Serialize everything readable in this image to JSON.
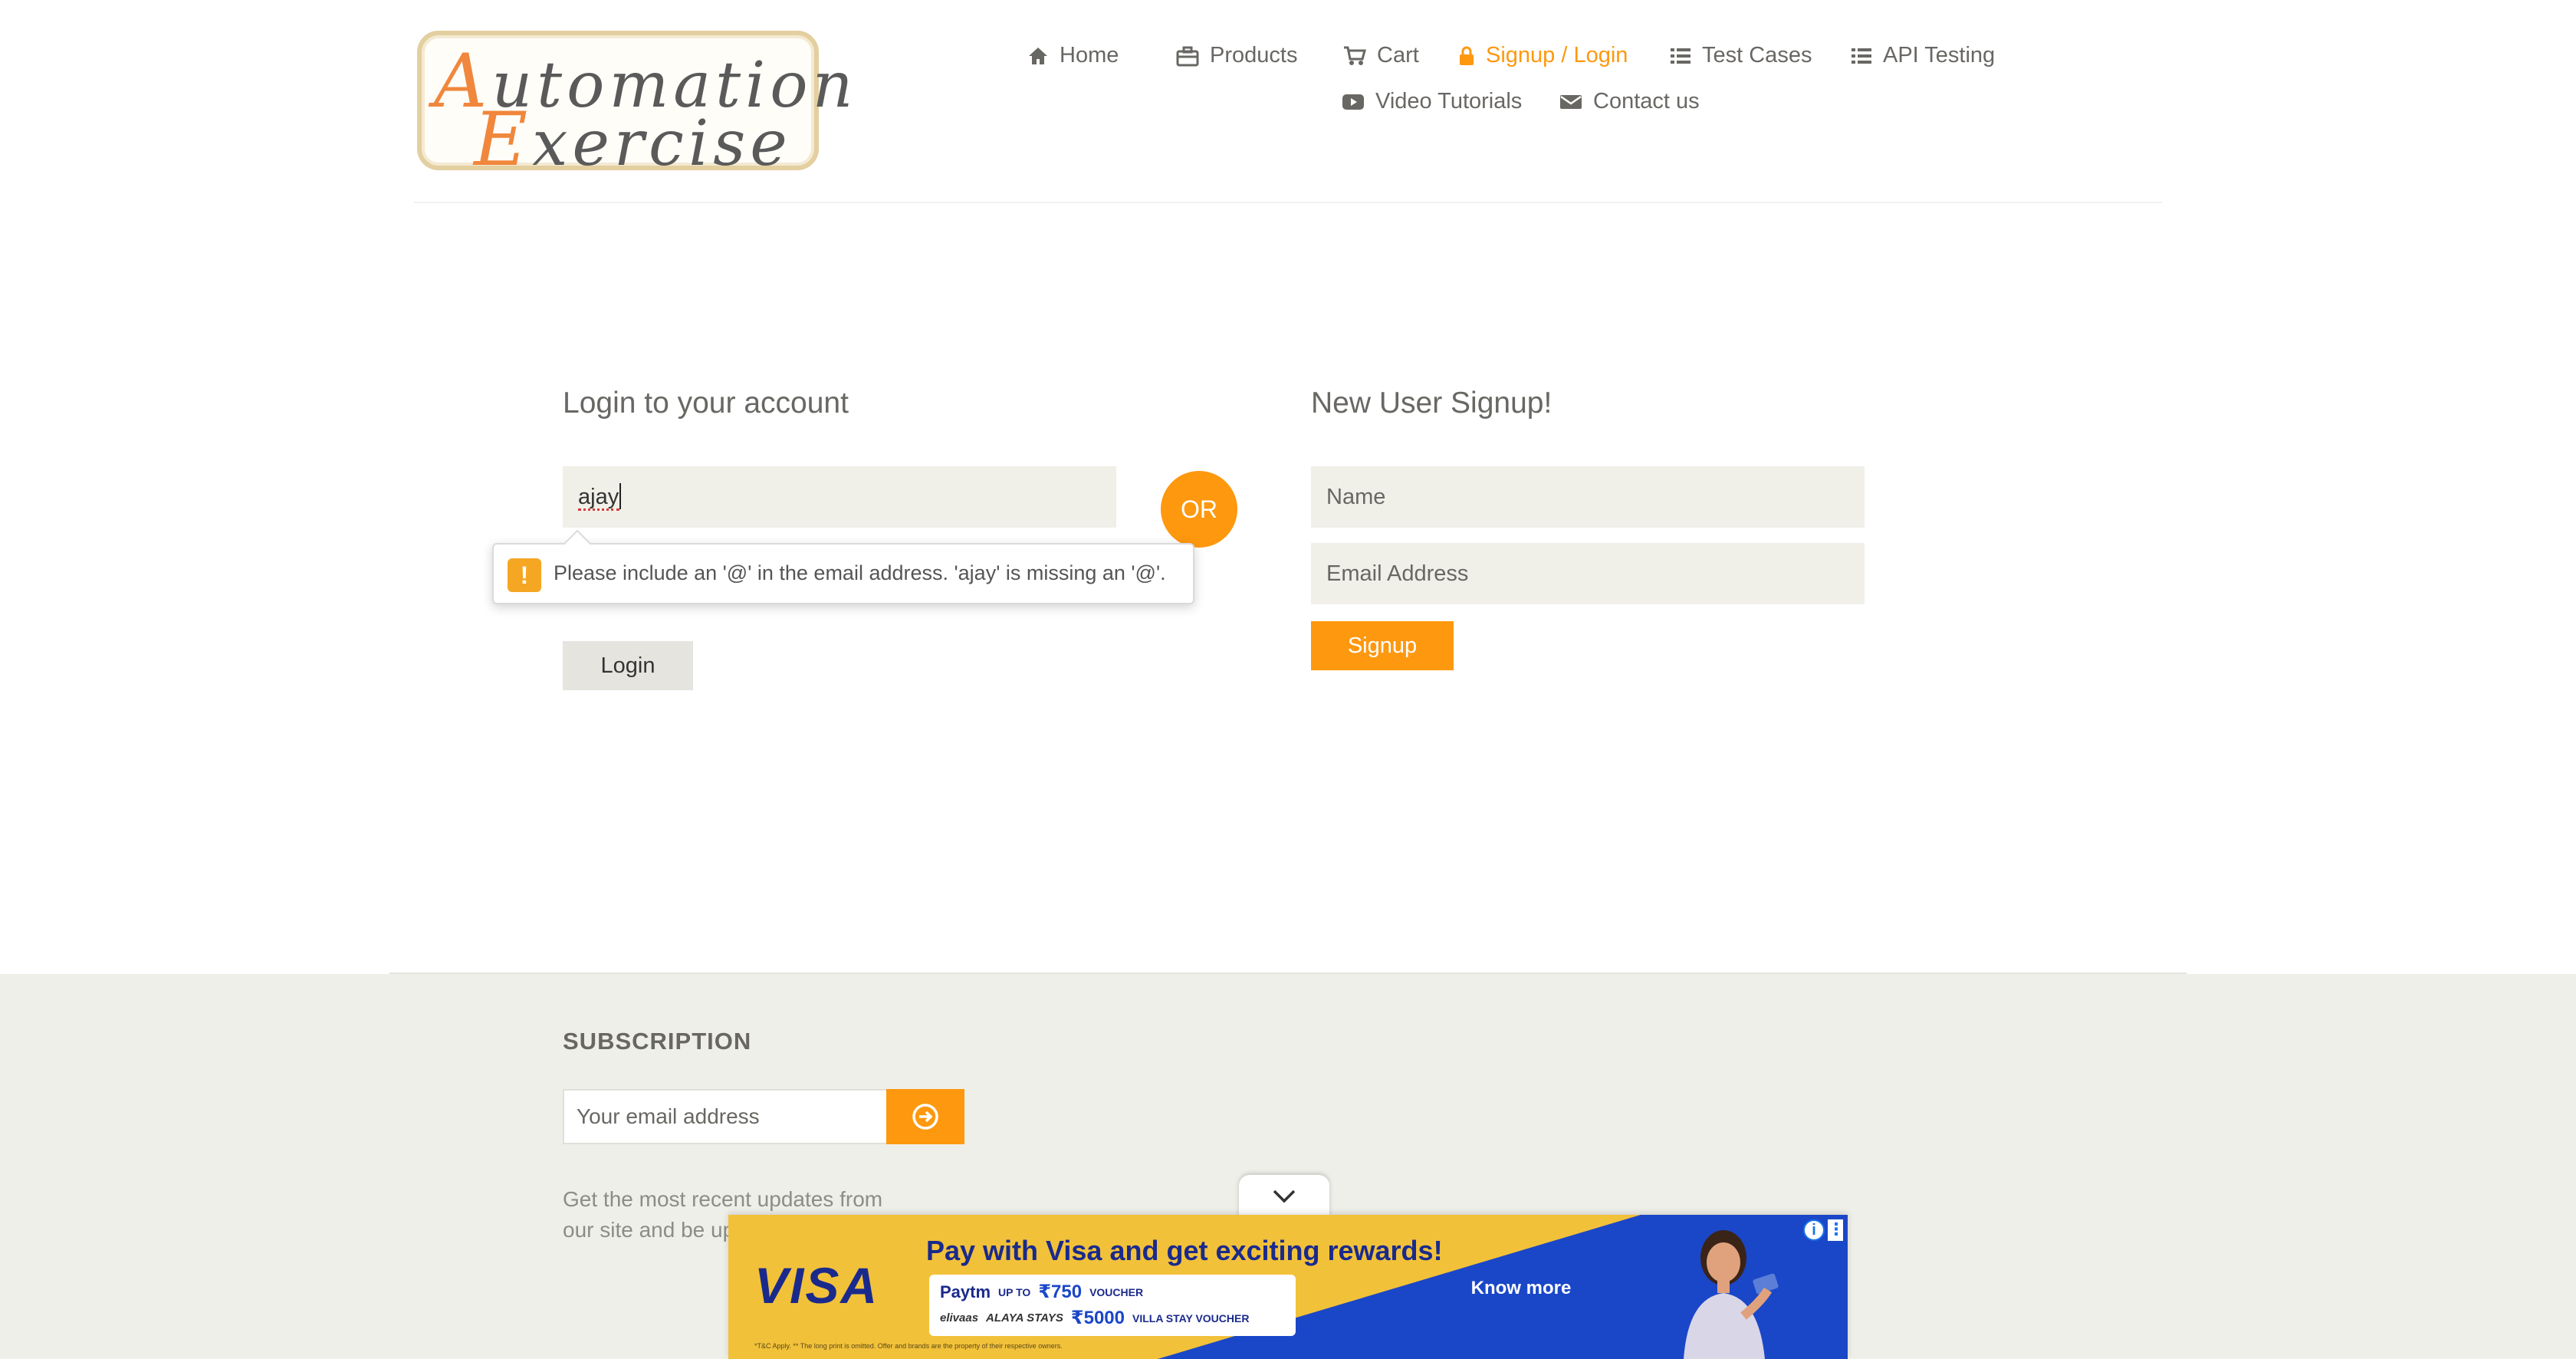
{
  "header": {
    "logo_line1": {
      "cap": "A",
      "rest": "utomation"
    },
    "logo_line2": {
      "cap": "E",
      "rest": "xercise"
    },
    "nav": [
      {
        "label": "Home",
        "icon": "home-icon"
      },
      {
        "label": "Products",
        "icon": "briefcase-icon"
      },
      {
        "label": "Cart",
        "icon": "cart-icon"
      },
      {
        "label": "Signup / Login",
        "icon": "lock-icon",
        "active": true
      },
      {
        "label": "Test Cases",
        "icon": "list-icon"
      },
      {
        "label": "API Testing",
        "icon": "list-icon"
      },
      {
        "label": "Video Tutorials",
        "icon": "youtube-play-icon"
      },
      {
        "label": "Contact us",
        "icon": "envelope-icon"
      }
    ]
  },
  "login": {
    "title": "Login to your account",
    "email_value": "ajay",
    "password_mask": "••••••••",
    "button": "Login",
    "validation_message": "Please include an '@' in the email address. 'ajay' is missing an '@'."
  },
  "or_label": "OR",
  "signup": {
    "title": "New User Signup!",
    "name_placeholder": "Name",
    "email_placeholder": "Email Address",
    "button": "Signup"
  },
  "footer": {
    "subscription_title": "SUBSCRIPTION",
    "email_placeholder": "Your email address",
    "description": "Get the most recent updates from our site and be up"
  },
  "ad": {
    "brand": "VISA",
    "headline": "Pay with Visa and get exciting rewards!",
    "paytm": "Paytm",
    "row1_prefix": "UP TO",
    "row1_amount": "₹750",
    "row1_suffix": "VOUCHER",
    "brand2": "elivaas",
    "brand3": "ALAYA STAYS",
    "row2_amount": "₹5000",
    "row2_suffix": "VILLA STAY VOUCHER",
    "cta": "Know more",
    "fine_print": "*T&C Apply. ** The long print is omitted. Offer and brands are the property of their respective owners."
  },
  "colors": {
    "accent": "#fe980f",
    "text": "#696763",
    "field_bg": "#f0f0e9",
    "footer_bg": "#efefe9",
    "visa_blue": "#1a47c8"
  }
}
